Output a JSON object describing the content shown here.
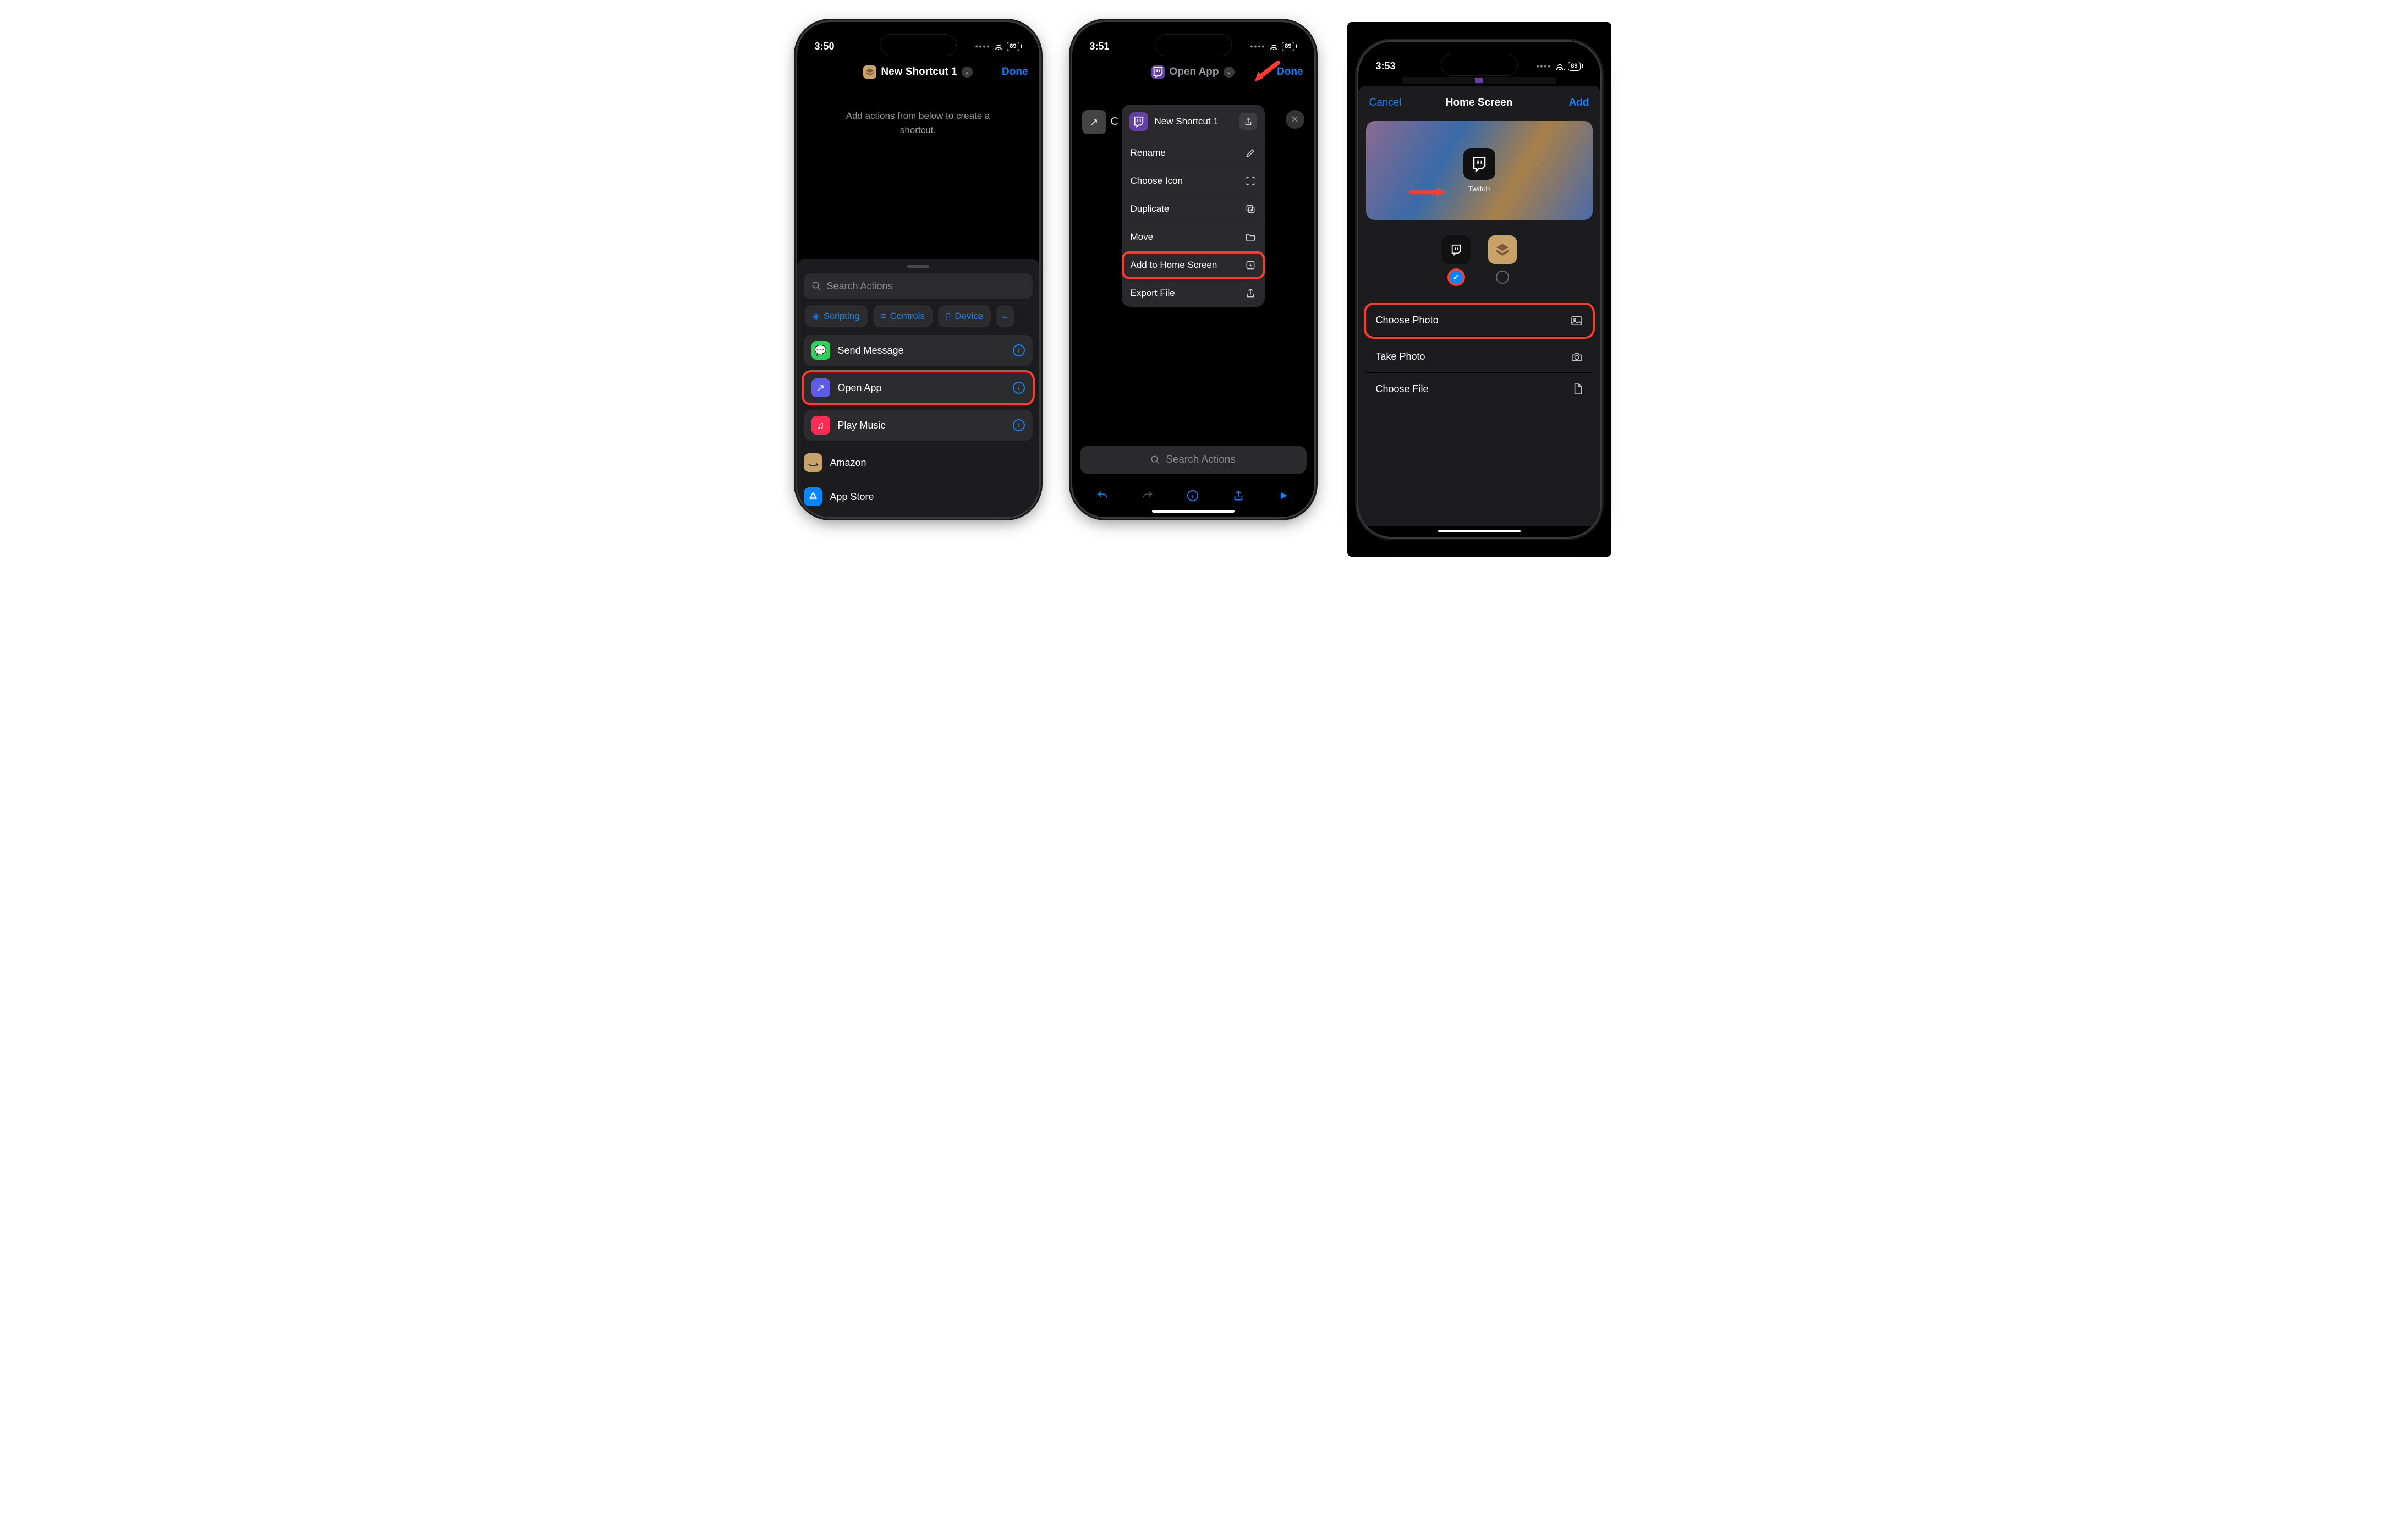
{
  "screen1": {
    "time": "3:50",
    "battery": "89",
    "title": "New Shortcut 1",
    "done": "Done",
    "hint": "Add actions from below to create a shortcut.",
    "search_placeholder": "Search Actions",
    "chips": [
      "Scripting",
      "Controls",
      "Device"
    ],
    "actions": [
      {
        "label": "Send Message",
        "icon": "messages",
        "color": "#30d158"
      },
      {
        "label": "Open App",
        "icon": "open",
        "color": "#5e5ce6"
      },
      {
        "label": "Play Music",
        "icon": "music",
        "color": "#ff2d55"
      },
      {
        "label": "Amazon",
        "icon": "amazon",
        "color": "#c9a26a"
      },
      {
        "label": "App Store",
        "icon": "appstore",
        "color": "#0a84ff"
      }
    ],
    "highlight_index": 1
  },
  "screen2": {
    "time": "3:51",
    "battery": "89",
    "title": "Open App",
    "done": "Done",
    "shortcut_name": "New Shortcut 1",
    "menu": [
      {
        "label": "Rename",
        "icon": "pencil"
      },
      {
        "label": "Choose Icon",
        "icon": "scan"
      },
      {
        "label": "Duplicate",
        "icon": "duplicate"
      },
      {
        "label": "Move",
        "icon": "folder"
      },
      {
        "label": "Add to Home Screen",
        "icon": "plus-square",
        "highlight": true
      },
      {
        "label": "Export File",
        "icon": "share"
      }
    ],
    "search_placeholder": "Search Actions"
  },
  "screen3": {
    "time": "3:53",
    "battery": "89",
    "cancel": "Cancel",
    "title": "Home Screen",
    "add": "Add",
    "app_label": "Twitch",
    "options": [
      {
        "label": "Choose Photo",
        "icon": "photo",
        "highlight": true
      },
      {
        "label": "Take Photo",
        "icon": "camera"
      },
      {
        "label": "Choose File",
        "icon": "file"
      }
    ]
  },
  "colors": {
    "blue": "#0a84ff",
    "red": "#ff3b30",
    "twitch": "#6441a5",
    "shortcuts_bg": "#c9a26a"
  }
}
